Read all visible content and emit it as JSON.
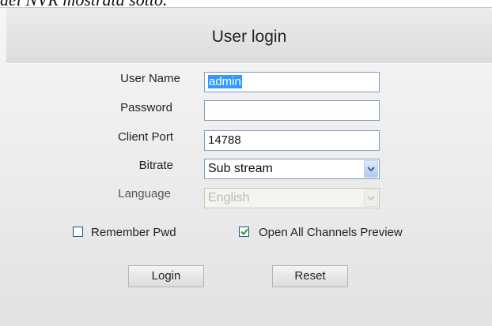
{
  "background_text": "del NVR mostrata sotto.",
  "dialog": {
    "title": "User login",
    "fields": {
      "username": {
        "label": "User Name",
        "value": "admin"
      },
      "password": {
        "label": "Password",
        "value": ""
      },
      "client_port": {
        "label": "Client Port",
        "value": "14788"
      },
      "bitrate": {
        "label": "Bitrate",
        "value": "Sub stream"
      },
      "language": {
        "label": "Language",
        "value": "English",
        "disabled": true
      }
    },
    "remember_pwd": {
      "label": "Remember Pwd",
      "checked": false
    },
    "open_all_channels": {
      "label": "Open All Channels Preview",
      "checked": true
    },
    "buttons": {
      "login": "Login",
      "reset": "Reset"
    }
  },
  "colors": {
    "accent": "#3399ff",
    "field_border": "#7f9db9",
    "checkmark": "#21a121"
  }
}
